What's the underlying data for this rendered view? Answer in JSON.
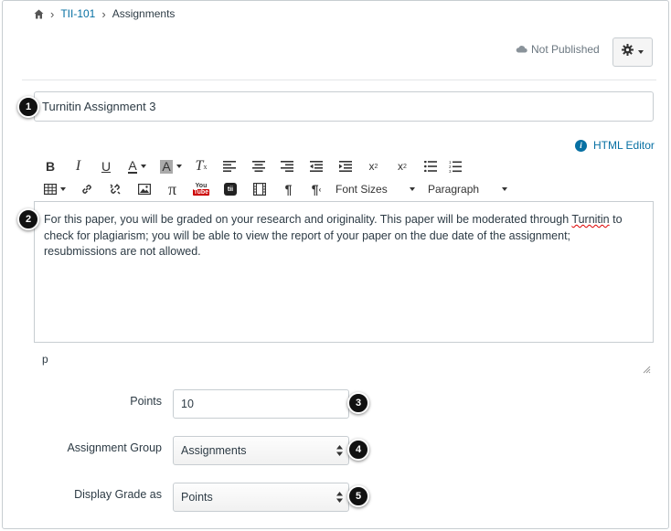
{
  "breadcrumb": {
    "home_icon": "home-icon",
    "course": "TII-101",
    "current": "Assignments"
  },
  "header": {
    "publish_status": "Not Published",
    "publish_icon": "cloud-icon",
    "settings_icon": "gear-icon"
  },
  "title_field": {
    "value": "Turnitin Assignment 3"
  },
  "callouts": {
    "c1": "1",
    "c2": "2",
    "c3": "3",
    "c4": "4",
    "c5": "5"
  },
  "editor": {
    "html_editor_link": "HTML Editor",
    "font_sizes_label": "Font Sizes",
    "paragraph_label": "Paragraph",
    "body_before": "For this paper, you will be graded on your research and originality. This paper will be moderated through ",
    "body_spell": "Turnitin",
    "body_after": " to check for plagiarism; you will be able to view the report of your paper on the due date of the assignment; resubmissions are not allowed.",
    "path": "p"
  },
  "form": {
    "points_label": "Points",
    "points_value": "10",
    "group_label": "Assignment Group",
    "group_value": "Assignments",
    "display_label": "Display Grade as",
    "display_value": "Points"
  },
  "colors": {
    "link": "#0770a3",
    "border": "#c7cdd1",
    "text": "#2d3b45"
  }
}
